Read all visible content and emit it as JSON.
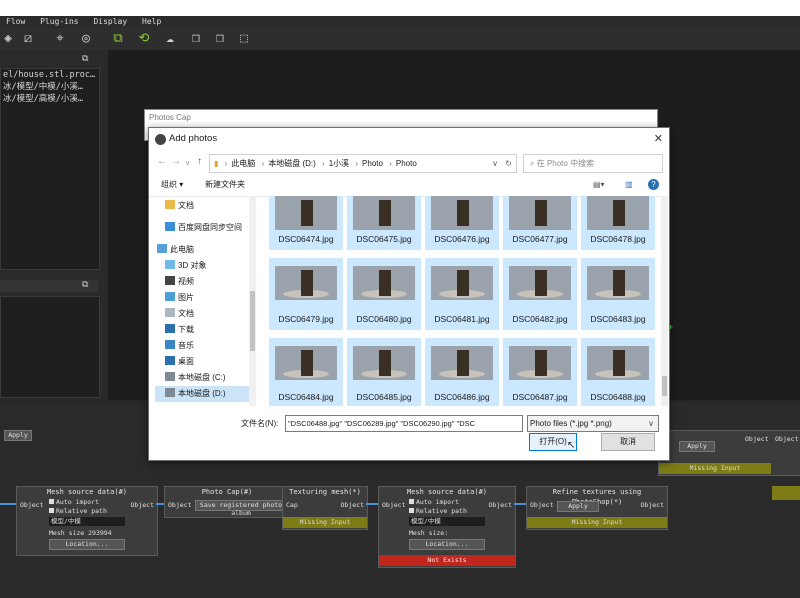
{
  "menu": [
    "Flow",
    "Plug-ins",
    "Display",
    "Help"
  ],
  "log": [
    "el/house.stl.proc…",
    "冰/模型/中模/小溪…",
    "冰/模型/高模/小溪…"
  ],
  "dialog_back_title": "Photos Cap",
  "dialog": {
    "title": "Add photos",
    "breadcrumb": [
      "此电脑",
      "本地磁盘 (D:)",
      "1小溪",
      "Photo",
      "Photo"
    ],
    "search_placeholder": "在 Photo 中搜索",
    "organize": "组织 ▾",
    "new_folder": "新建文件夹",
    "nav_items": [
      {
        "label": "文档",
        "icon": "folder-icon"
      },
      {
        "label": "百度网盘同步空间",
        "icon": "cloud-icon"
      },
      {
        "label": "此电脑",
        "icon": "computer-icon"
      },
      {
        "label": "3D 对象",
        "icon": "cube-icon"
      },
      {
        "label": "视频",
        "icon": "video-icon"
      },
      {
        "label": "图片",
        "icon": "picture-icon"
      },
      {
        "label": "文档",
        "icon": "document-icon"
      },
      {
        "label": "下载",
        "icon": "download-icon"
      },
      {
        "label": "音乐",
        "icon": "music-icon"
      },
      {
        "label": "桌面",
        "icon": "desktop-icon"
      },
      {
        "label": "本地磁盘 (C:)",
        "icon": "drive-icon"
      },
      {
        "label": "本地磁盘 (D:)",
        "icon": "drive-icon"
      }
    ],
    "files_row1": [
      "DSC06474.jpg",
      "DSC06475.jpg",
      "DSC06476.jpg",
      "DSC06477.jpg",
      "DSC06478.jpg"
    ],
    "files_row2": [
      "DSC06479.jpg",
      "DSC06480.jpg",
      "DSC06481.jpg",
      "DSC06482.jpg",
      "DSC06483.jpg"
    ],
    "files_row3": [
      "DSC06484.jpg",
      "DSC06485.jpg",
      "DSC06486.jpg",
      "DSC06487.jpg",
      "DSC06488.jpg"
    ],
    "filename_label": "文件名(N):",
    "filename_value": "\"DSC06488.jpg\" \"DSC06289.jpg\" \"DSC06290.jpg\" \"DSC",
    "filetype": "Photo files (*.jpg *.png)",
    "open": "打开(O)",
    "cancel": "取消"
  },
  "nodes": {
    "apply": "Apply",
    "mesh1": {
      "title": "Mesh source data(#)",
      "auto": "Auto import",
      "rel": "Relative path",
      "field": "模型/中模",
      "size": "Mesh size 293994",
      "loc": "Location...",
      "port_in": "Object",
      "port_out": "Object"
    },
    "photocap": {
      "title": "Photo Cap(#)",
      "save": "Save registered photo album",
      "port_in": "Object"
    },
    "texturing": {
      "title": "Texturing mesh(*)",
      "cap": "Cap",
      "obj": "Object",
      "status": "Missing Input"
    },
    "mesh2": {
      "title": "Mesh source data(#)",
      "auto": "Auto import",
      "rel": "Relative path",
      "field": "模型/中模",
      "size": "Mesh size:",
      "loc": "Location...",
      "port_in": "Object",
      "port_out": "Object",
      "status": "Not Exists"
    },
    "refine": {
      "title": "Refine textures using PhotoShop(*)",
      "in": "Object",
      "apply": "Apply",
      "out": "Object",
      "status": "Missing Input"
    },
    "right": {
      "apply": "Apply",
      "obj1": "Object",
      "obj2": "Object",
      "status": "Missing Input"
    }
  }
}
